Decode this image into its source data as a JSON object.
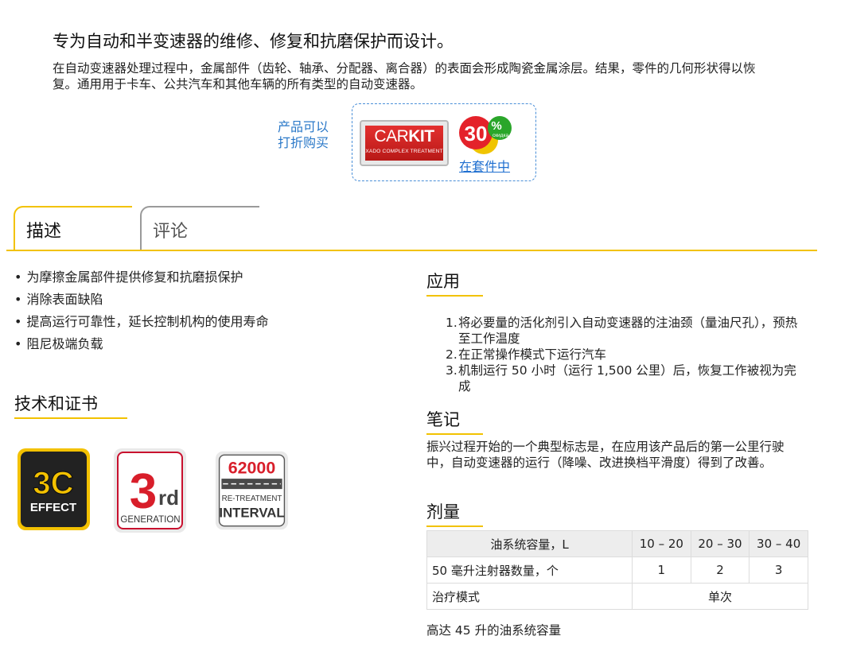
{
  "headline": "专为自动和半变速器的维修、修复和抗磨保护而设计。",
  "intro": "在自动变速器处理过程中，金属部件（齿轮、轴承、分配器、离合器）的表面会形成陶瓷金属涂层。结果，零件的几何形状得以恢复。通用用于卡车、公共汽车和其他车辆的所有类型的自动变速器。",
  "offer": {
    "label_line1": "产品可以",
    "label_line2": "打折购买",
    "carkit_light": "CAR",
    "carkit_bold": "KIT",
    "carkit_sub": "XADO COMPLEX TREATMENT",
    "discount_number": "30",
    "discount_percent": "%",
    "discount_word": "скидка",
    "link_text": "在套件中"
  },
  "tabs": {
    "description": "描述",
    "reviews": "评论"
  },
  "features": [
    "为摩擦金属部件提供修复和抗磨损保护",
    "消除表面缺陷",
    "提高运行可靠性，延长控制机构的使用寿命",
    "阻尼极端负载"
  ],
  "tech": {
    "title": "技术和证书",
    "badge1": {
      "big": "3C",
      "small": "EFFECT"
    },
    "badge2": {
      "big": "3",
      "sup": "rd",
      "small": "GENERATION"
    },
    "badge3": {
      "number": "62000",
      "line1": "RE-TREATMENT",
      "line2": "INTERVAL"
    }
  },
  "usage": {
    "title": "应用",
    "steps": [
      {
        "num": "1.",
        "text": "将必要量的活化剂引入自动变速器的注油颈（量油尺孔），预热至工作温度"
      },
      {
        "num": "2.",
        "text": "在正常操作模式下运行汽车"
      },
      {
        "num": "3.",
        "text": "机制运行 50 小时（运行 1,500 公里）后，恢复工作被视为完成"
      }
    ]
  },
  "notes": {
    "title": "笔记",
    "text": "振兴过程开始的一个典型标志是，在应用该产品后的第一公里行驶中，自动变速器的运行（降噪、改进换档平滑度）得到了改善。"
  },
  "dosage": {
    "title": "剂量",
    "header_label": "油系统容量，L",
    "ranges": [
      "10 – 20",
      "20 – 30",
      "30 – 40"
    ],
    "syringe_label": "50 毫升注射器数量，个",
    "syringe_counts": [
      "1",
      "2",
      "3"
    ],
    "mode_label": "治疗模式",
    "mode_value": "单次",
    "footnote": "高达 45 升的油系统容量"
  },
  "colors": {
    "accent": "#f2c200",
    "link": "#1f6fd0",
    "offer_border": "#4a8fd8",
    "carkit_red": "#d42422",
    "badge_bg": "#e9e9e9"
  }
}
